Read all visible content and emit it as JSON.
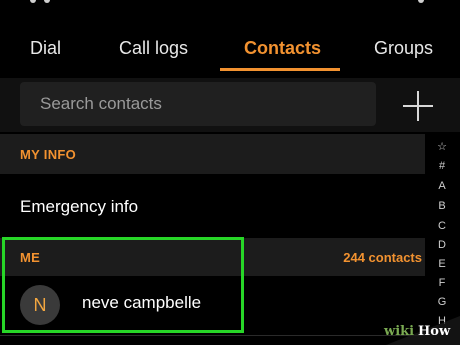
{
  "tabs": [
    {
      "label": "Dial"
    },
    {
      "label": "Call logs"
    },
    {
      "label": "Contacts"
    },
    {
      "label": "Groups"
    }
  ],
  "search": {
    "placeholder": "Search contacts"
  },
  "my_info": {
    "header": "MY INFO",
    "emergency_label": "Emergency info"
  },
  "me_section": {
    "header": "ME",
    "count": "244 contacts",
    "contact": {
      "initial": "N",
      "name": "neve campbelle"
    }
  },
  "index": [
    "☆",
    "#",
    "A",
    "B",
    "C",
    "D",
    "E",
    "F",
    "G",
    "H"
  ],
  "watermark": {
    "wiki": "wiki",
    "how": "How"
  },
  "colors": {
    "accent": "#f29230",
    "highlight": "#27d627"
  }
}
